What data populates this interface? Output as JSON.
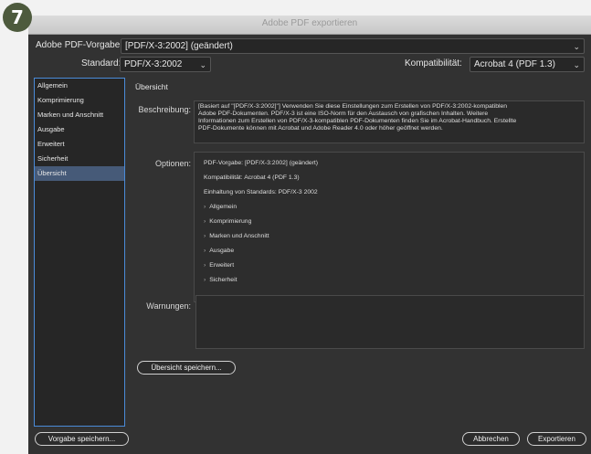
{
  "step_badge": "7",
  "window": {
    "title": "Adobe PDF exportieren"
  },
  "preset": {
    "label": "Adobe PDF-Vorgabe:",
    "value": "[PDF/X-3:2002] (geändert)"
  },
  "standard": {
    "label": "Standard:",
    "value": "PDF/X-3:2002"
  },
  "compat": {
    "label": "Kompatibilität:",
    "value": "Acrobat 4 (PDF 1.3)"
  },
  "sidebar": {
    "items": [
      {
        "label": "Allgemein"
      },
      {
        "label": "Komprimierung"
      },
      {
        "label": "Marken und Anschnitt"
      },
      {
        "label": "Ausgabe"
      },
      {
        "label": "Erweitert"
      },
      {
        "label": "Sicherheit"
      },
      {
        "label": "Übersicht"
      }
    ],
    "selected": "Übersicht"
  },
  "summary": {
    "title": "Übersicht",
    "desc_label": "Beschreibung:",
    "desc_lines": [
      "[Basiert auf \"[PDF/X-3:2002]\"] Verwenden Sie diese Einstellungen zum Erstellen von PDF/X-3:2002-kompatiblen",
      "Adobe PDF-Dokumenten. PDF/X-3 ist eine ISO-Norm für den Austausch von grafischen Inhalten. Weitere",
      "Informationen zum Erstellen von PDF/X-3-kompatiblen PDF-Dokumenten finden Sie im Acrobat-Handbuch. Erstellte",
      "PDF-Dokumente können mit Acrobat und Adobe Reader 4.0 oder höher geöffnet werden."
    ],
    "options_label": "Optionen:",
    "options": [
      "PDF-Vorgabe: [PDF/X-3:2002] (geändert)",
      "Kompatibilität: Acrobat 4 (PDF 1.3)",
      "Einhaltung von Standards: PDF/X-3 2002"
    ],
    "sections": [
      "Allgemein",
      "Komprimierung",
      "Marken und Anschnitt",
      "Ausgabe",
      "Erweitert",
      "Sicherheit"
    ],
    "warnings_label": "Warnungen:",
    "save_summary": "Übersicht speichern..."
  },
  "footer": {
    "save_preset": "Vorgabe speichern...",
    "cancel": "Abbrechen",
    "export": "Exportieren"
  }
}
